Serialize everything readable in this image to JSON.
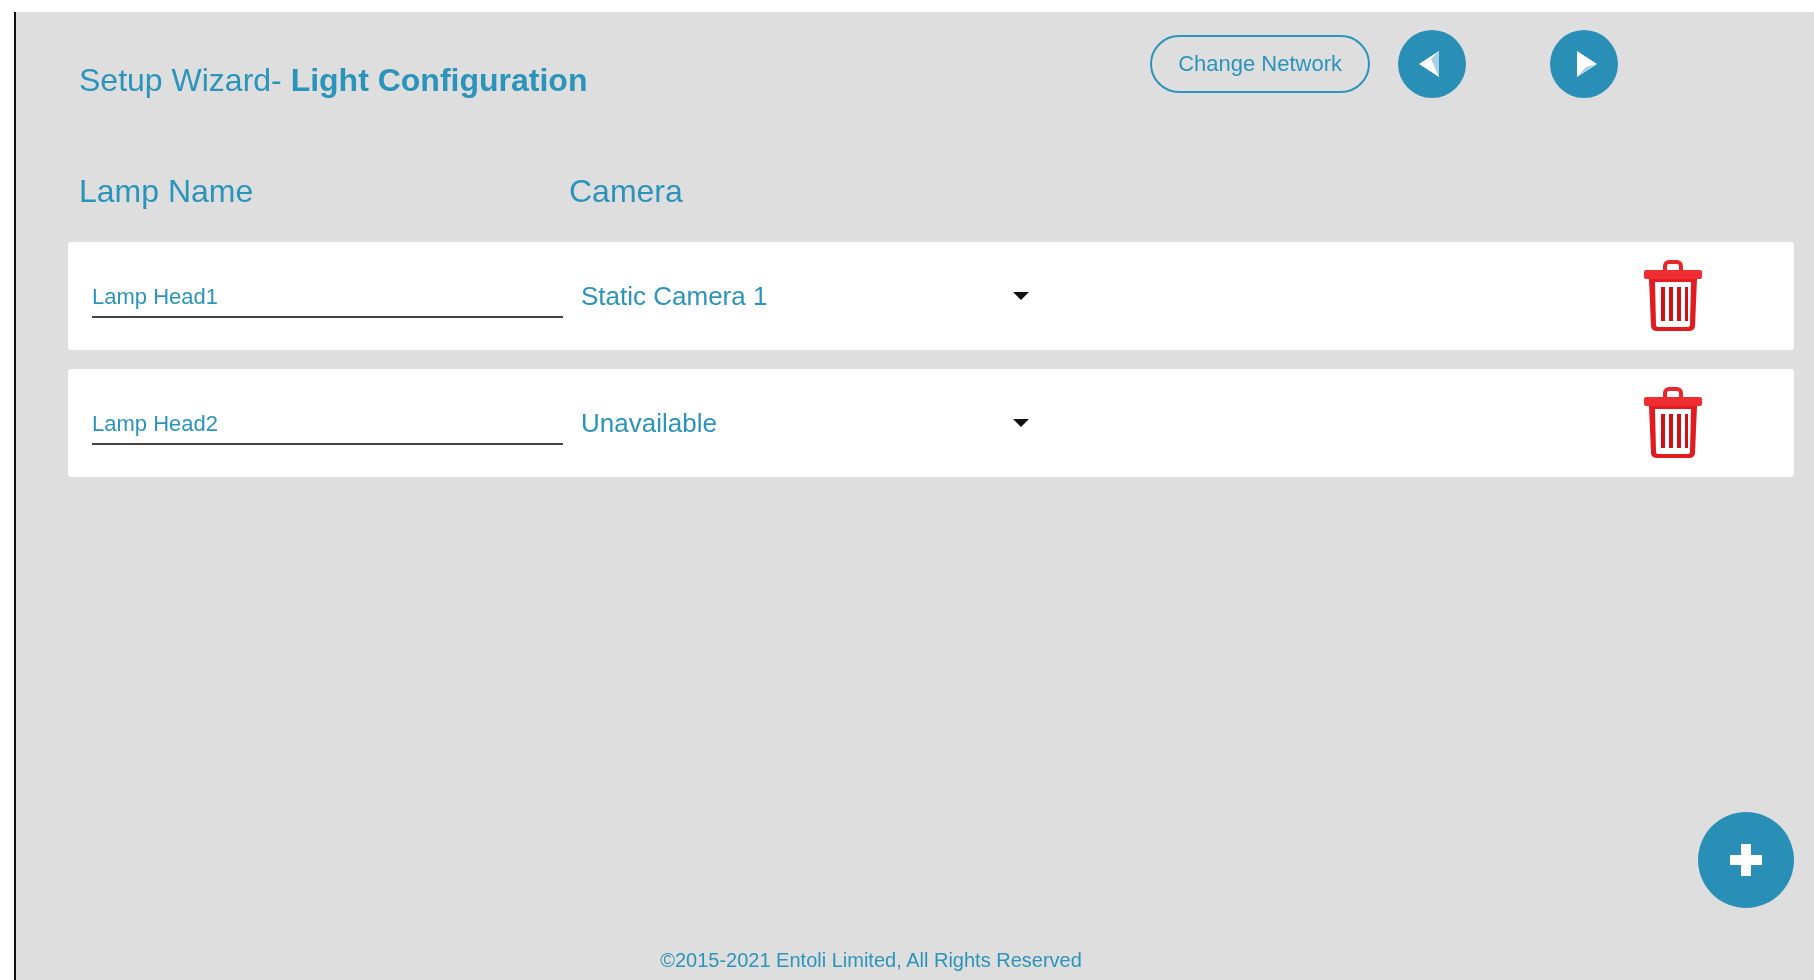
{
  "header": {
    "title": "Setup Wizard- **Light Configuration**",
    "change_network_button": "Change Network"
  },
  "columns": [
    "Lamp Name",
    "Camera"
  ],
  "lamps": [
    {
      "name": "Lamp Head1",
      "camera": "Static Camera 1"
    },
    {
      "name": "Lamp Head2",
      "camera": "Unavailable"
    }
  ],
  "footer": "©2015-2021 Entoli Limited, All Rights Reserved"
}
